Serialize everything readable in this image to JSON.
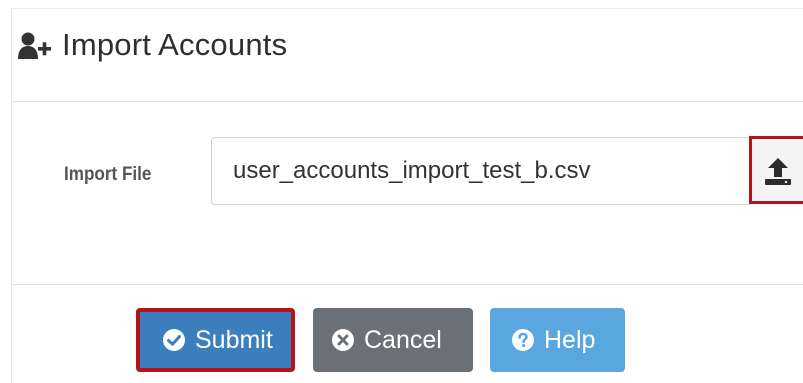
{
  "header": {
    "title": "Import Accounts",
    "icon": "add-user-icon"
  },
  "form": {
    "import_file_label": "Import File",
    "import_file_value": "user_accounts_import_test_b.csv",
    "upload_icon": "upload-icon"
  },
  "buttons": {
    "submit_label": "Submit",
    "cancel_label": "Cancel",
    "help_label": "Help"
  },
  "colors": {
    "submit": "#3c7fbd",
    "cancel": "#6b7076",
    "help": "#5aa7e0",
    "highlight_border": "#b5121b"
  }
}
